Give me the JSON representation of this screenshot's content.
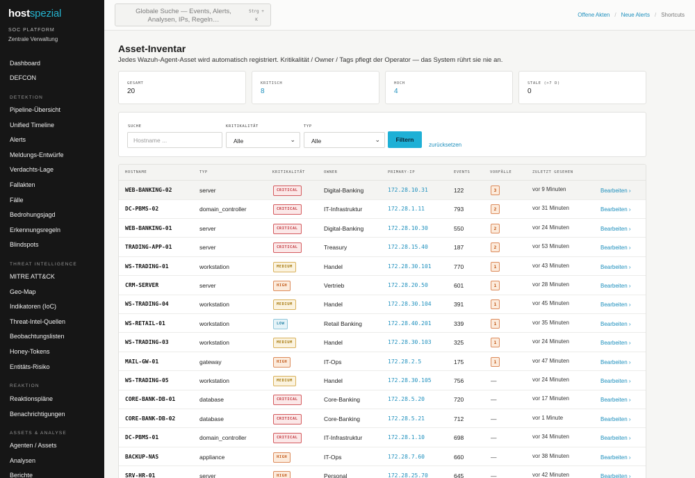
{
  "sidebar": {
    "logo_main": "host",
    "logo_accent": "spezial",
    "platform": "SOC PLATFORM",
    "platform_sub": "Zentrale Verwaltung",
    "items": [
      {
        "label": "Dashboard"
      },
      {
        "label": "DEFCON"
      },
      {
        "section": "DETEKTION"
      },
      {
        "label": "Pipeline-Übersicht"
      },
      {
        "label": "Unified Timeline"
      },
      {
        "label": "Alerts"
      },
      {
        "label": "Meldungs-Entwürfe"
      },
      {
        "label": "Verdachts-Lage"
      },
      {
        "label": "Fallakten"
      },
      {
        "label": "Fälle"
      },
      {
        "label": "Bedrohungsjagd"
      },
      {
        "label": "Erkennungsregeln"
      },
      {
        "label": "Blindspots"
      },
      {
        "section": "THREAT INTELLIGENCE"
      },
      {
        "label": "MITRE ATT&CK"
      },
      {
        "label": "Geo-Map"
      },
      {
        "label": "Indikatoren (IoC)"
      },
      {
        "label": "Threat-Intel-Quellen"
      },
      {
        "label": "Beobachtungslisten"
      },
      {
        "label": "Honey-Tokens"
      },
      {
        "label": "Entitäts-Risiko"
      },
      {
        "section": "REAKTION"
      },
      {
        "label": "Reaktionspläne"
      },
      {
        "label": "Benachrichtigungen"
      },
      {
        "section": "ASSETS & ANALYSE"
      },
      {
        "label": "Agenten / Assets"
      },
      {
        "label": "Analysen"
      },
      {
        "label": "Berichte"
      }
    ]
  },
  "topbar": {
    "search_text": "Globale Suche — Events, Alerts, Analysen, IPs, Regeln…",
    "shortcut": "Strg + K",
    "links": [
      "Offene Akten",
      "Neue Alerts",
      "Shortcuts"
    ]
  },
  "page": {
    "title": "Asset-Inventar",
    "subtitle": "Jedes Wazuh-Agent-Asset wird automatisch registriert. Kritikalität / Owner / Tags pflegt der Operator — das System rührt sie nie an."
  },
  "stats": [
    {
      "label": "GESAMT",
      "value": "20",
      "color": "#1d1d1d"
    },
    {
      "label": "KRITISCH",
      "value": "8",
      "color": "#1d8fbd"
    },
    {
      "label": "HOCH",
      "value": "4",
      "color": "#1d8fbd"
    },
    {
      "label": "STALE (>7 D)",
      "value": "0",
      "color": "#1d1d1d"
    }
  ],
  "filters": {
    "search_label": "SUCHE",
    "search_placeholder": "Hostname ...",
    "crit_label": "KRITIKALITÄT",
    "crit_value": "Alle",
    "type_label": "TYP",
    "type_value": "Alle",
    "filter_button": "Filtern",
    "reset_link": "zurücksetzen"
  },
  "table": {
    "headers": [
      "HOSTNAME",
      "TYP",
      "KRITIKALITÄT",
      "OWNER",
      "PRIMARY-IP",
      "EVENTS",
      "VORFÄLLE",
      "ZULETZT GESEHEN"
    ],
    "edit_label": "Bearbeiten ›",
    "rows": [
      {
        "host": "WEB-BANKING-02",
        "type": "server",
        "crit": "CRITICAL",
        "crit_class": "critical",
        "owner": "Digital-Banking",
        "ip": "172.28.10.31",
        "events": "122",
        "incidents": "3",
        "seen": "vor 9 Minuten"
      },
      {
        "host": "DC-PBMS-02",
        "type": "domain_controller",
        "crit": "CRITICAL",
        "crit_class": "critical",
        "owner": "IT-Infrastruktur",
        "ip": "172.28.1.11",
        "events": "793",
        "incidents": "2",
        "seen": "vor 31 Minuten"
      },
      {
        "host": "WEB-BANKING-01",
        "type": "server",
        "crit": "CRITICAL",
        "crit_class": "critical",
        "owner": "Digital-Banking",
        "ip": "172.28.10.30",
        "events": "550",
        "incidents": "2",
        "seen": "vor 24 Minuten"
      },
      {
        "host": "TRADING-APP-01",
        "type": "server",
        "crit": "CRITICAL",
        "crit_class": "critical",
        "owner": "Treasury",
        "ip": "172.28.15.40",
        "events": "187",
        "incidents": "2",
        "seen": "vor 53 Minuten"
      },
      {
        "host": "WS-TRADING-01",
        "type": "workstation",
        "crit": "MEDIUM",
        "crit_class": "medium",
        "owner": "Handel",
        "ip": "172.28.30.101",
        "events": "770",
        "incidents": "1",
        "seen": "vor 43 Minuten"
      },
      {
        "host": "CRM-SERVER",
        "type": "server",
        "crit": "HIGH",
        "crit_class": "high",
        "owner": "Vertrieb",
        "ip": "172.28.20.50",
        "events": "601",
        "incidents": "1",
        "seen": "vor 28 Minuten"
      },
      {
        "host": "WS-TRADING-04",
        "type": "workstation",
        "crit": "MEDIUM",
        "crit_class": "medium",
        "owner": "Handel",
        "ip": "172.28.30.104",
        "events": "391",
        "incidents": "1",
        "seen": "vor 45 Minuten"
      },
      {
        "host": "WS-RETAIL-01",
        "type": "workstation",
        "crit": "LOW",
        "crit_class": "low",
        "owner": "Retail Banking",
        "ip": "172.28.40.201",
        "events": "339",
        "incidents": "1",
        "seen": "vor 35 Minuten"
      },
      {
        "host": "WS-TRADING-03",
        "type": "workstation",
        "crit": "MEDIUM",
        "crit_class": "medium",
        "owner": "Handel",
        "ip": "172.28.30.103",
        "events": "325",
        "incidents": "1",
        "seen": "vor 24 Minuten"
      },
      {
        "host": "MAIL-GW-01",
        "type": "gateway",
        "crit": "HIGH",
        "crit_class": "high",
        "owner": "IT-Ops",
        "ip": "172.28.2.5",
        "events": "175",
        "incidents": "1",
        "seen": "vor 47 Minuten"
      },
      {
        "host": "WS-TRADING-05",
        "type": "workstation",
        "crit": "MEDIUM",
        "crit_class": "medium",
        "owner": "Handel",
        "ip": "172.28.30.105",
        "events": "756",
        "incidents": "—",
        "seen": "vor 24 Minuten"
      },
      {
        "host": "CORE-BANK-DB-01",
        "type": "database",
        "crit": "CRITICAL",
        "crit_class": "critical",
        "owner": "Core-Banking",
        "ip": "172.28.5.20",
        "events": "720",
        "incidents": "—",
        "seen": "vor 17 Minuten"
      },
      {
        "host": "CORE-BANK-DB-02",
        "type": "database",
        "crit": "CRITICAL",
        "crit_class": "critical",
        "owner": "Core-Banking",
        "ip": "172.28.5.21",
        "events": "712",
        "incidents": "—",
        "seen": "vor 1 Minute"
      },
      {
        "host": "DC-PBMS-01",
        "type": "domain_controller",
        "crit": "CRITICAL",
        "crit_class": "critical",
        "owner": "IT-Infrastruktur",
        "ip": "172.28.1.10",
        "events": "698",
        "incidents": "—",
        "seen": "vor 34 Minuten"
      },
      {
        "host": "BACKUP-NAS",
        "type": "appliance",
        "crit": "HIGH",
        "crit_class": "high",
        "owner": "IT-Ops",
        "ip": "172.28.7.60",
        "events": "660",
        "incidents": "—",
        "seen": "vor 38 Minuten"
      },
      {
        "host": "SRV-HR-01",
        "type": "server",
        "crit": "HIGH",
        "crit_class": "high",
        "owner": "Personal",
        "ip": "172.28.25.70",
        "events": "645",
        "incidents": "—",
        "seen": "vor 42 Minuten"
      }
    ]
  }
}
